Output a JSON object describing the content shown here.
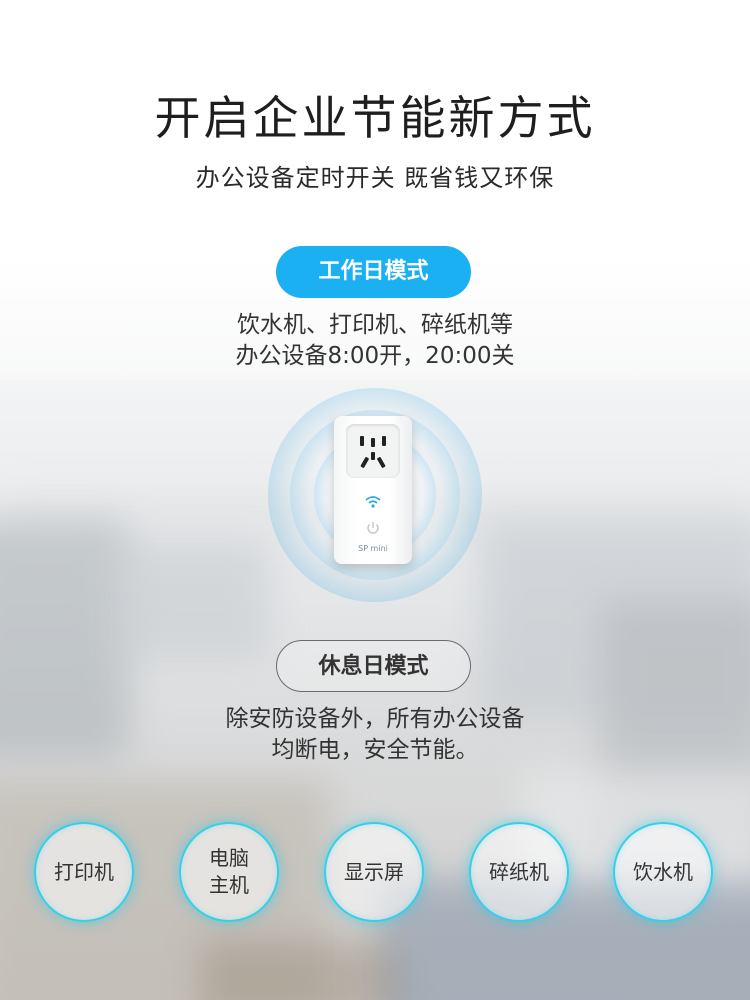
{
  "header": {
    "title": "开启企业节能新方式",
    "subtitle": "办公设备定时开关 既省钱又环保"
  },
  "workday": {
    "mode_label": "工作日模式",
    "desc_line1": "饮水机、打印机、碎纸机等",
    "desc_line2": "办公设备8:00开，20:00关"
  },
  "device": {
    "label": "SP mini",
    "icons": [
      "wifi-icon",
      "power-icon",
      "socket-icon"
    ]
  },
  "restday": {
    "mode_label": "休息日模式",
    "desc_line1": "除安防设备外，所有办公设备",
    "desc_line2": "均断电，安全节能。"
  },
  "appliances": [
    {
      "label": "打印机"
    },
    {
      "label": "电脑\n主机"
    },
    {
      "label": "显示屏"
    },
    {
      "label": "碎纸机"
    },
    {
      "label": "饮水机"
    }
  ],
  "colors": {
    "accent_blue": "#1ab0f2",
    "ring_cyan": "#33d0ea",
    "text_dark": "#1e1e1e"
  }
}
